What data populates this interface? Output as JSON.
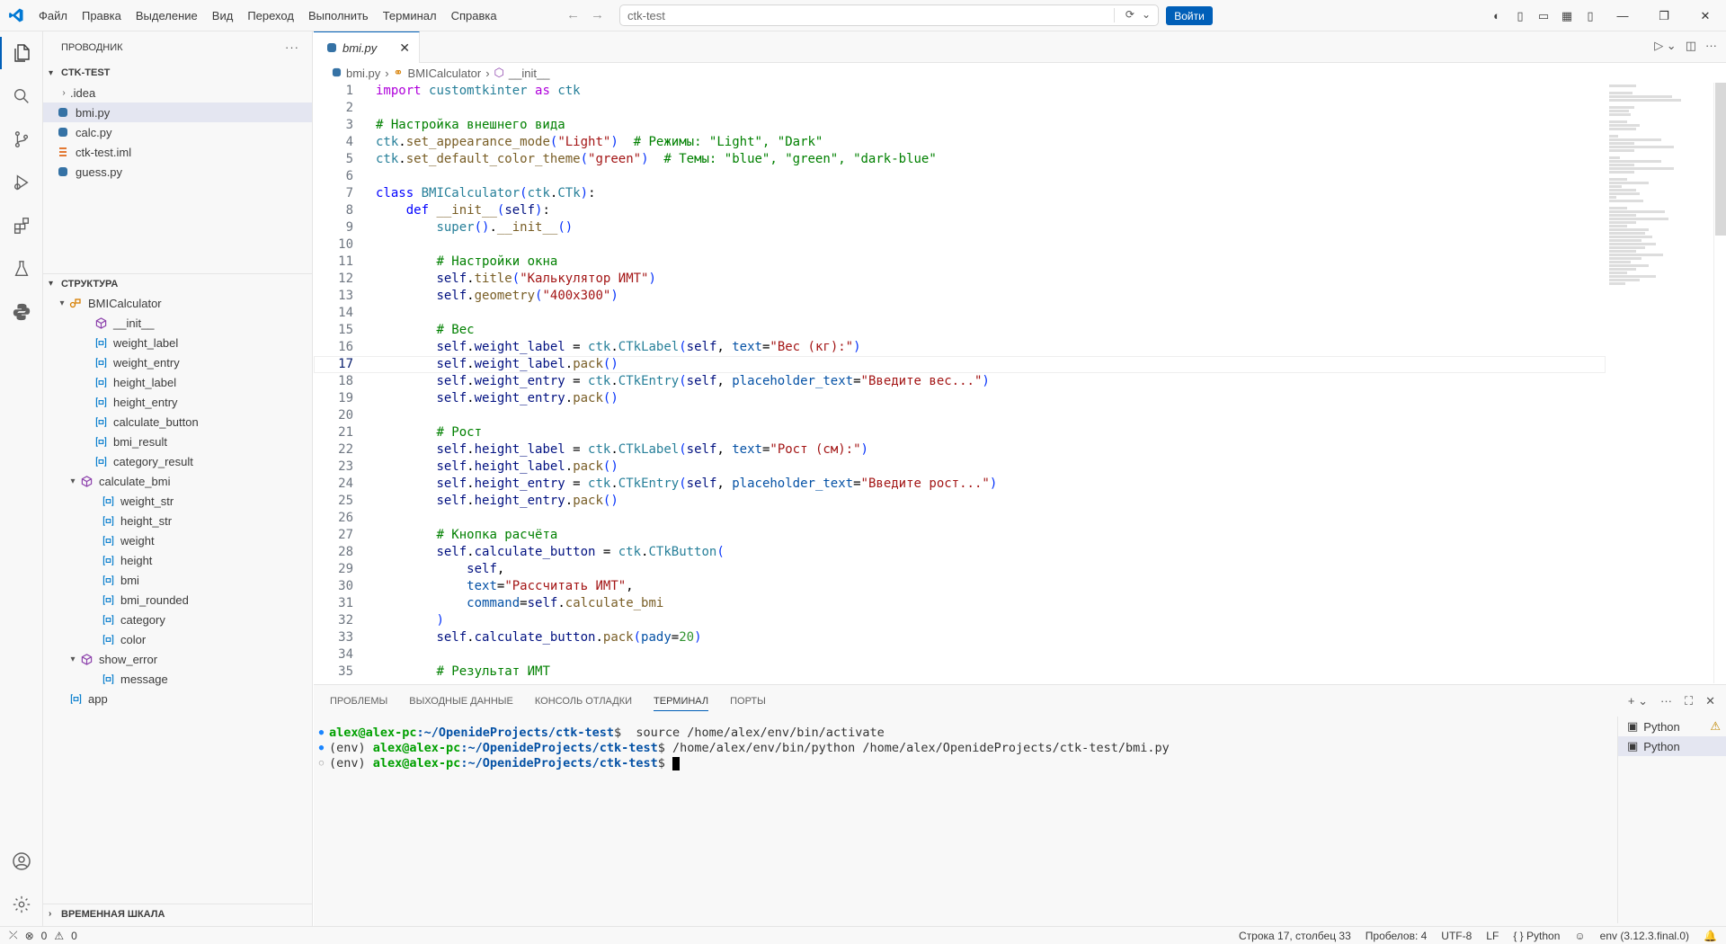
{
  "menu": [
    "Файл",
    "Правка",
    "Выделение",
    "Вид",
    "Переход",
    "Выполнить",
    "Терминал",
    "Справка"
  ],
  "command_center": "ctk-test",
  "signin_label": "Войти",
  "explorer": {
    "header": "ПРОВОДНИК",
    "project": "CTK-TEST",
    "files": [
      {
        "name": ".idea",
        "icon": "folder-icon"
      },
      {
        "name": "bmi.py",
        "icon": "python-file-icon"
      },
      {
        "name": "calc.py",
        "icon": "python-file-icon"
      },
      {
        "name": "ctk-test.iml",
        "icon": "xml-file-icon"
      },
      {
        "name": "guess.py",
        "icon": "python-file-icon"
      }
    ]
  },
  "outline": {
    "title": "СТРУКТУРА",
    "class_name": "BMICalculator",
    "items": [
      "__init__",
      "weight_label",
      "weight_entry",
      "height_label",
      "height_entry",
      "calculate_button",
      "bmi_result",
      "category_result",
      "calculate_bmi",
      "weight_str",
      "height_str",
      "weight",
      "height",
      "bmi",
      "bmi_rounded",
      "category",
      "color",
      "show_error",
      "message",
      "app"
    ]
  },
  "timeline_title": "ВРЕМЕННАЯ ШКАЛА",
  "editor": {
    "tab_label": "bmi.py",
    "breadcrumb": [
      "bmi.py",
      "BMICalculator",
      "__init__"
    ],
    "line_numbers": [
      "1",
      "2",
      "3",
      "4",
      "5",
      "6",
      "7",
      "8",
      "9",
      "10",
      "11",
      "12",
      "13",
      "14",
      "15",
      "16",
      "17",
      "18",
      "19",
      "20",
      "21",
      "22",
      "23",
      "24",
      "25",
      "26",
      "27",
      "28",
      "29",
      "30",
      "31",
      "32",
      "33",
      "34",
      "35"
    ],
    "current_line": 17
  },
  "panel": {
    "tabs": [
      "ПРОБЛЕМЫ",
      "ВЫХОДНЫЕ ДАННЫЕ",
      "КОНСОЛЬ ОТЛАДКИ",
      "ТЕРМИНАЛ",
      "ПОРТЫ"
    ],
    "active_tab": "ТЕРМИНАЛ",
    "terminal": {
      "user": "alex@alex-pc",
      "path": ":~/OpenideProjects/ctk-test",
      "env": "(env) ",
      "cmd1": "$  source /home/alex/env/bin/activate",
      "cmd2": "$ /home/alex/env/bin/python /home/alex/OpenideProjects/ctk-test/bmi.py",
      "prompt_end": "$ "
    },
    "terminal_list": [
      "Python",
      "Python"
    ]
  },
  "status": {
    "errors": "0",
    "warnings": "0",
    "position": "Строка 17, столбец 33",
    "spaces": "Пробелов: 4",
    "encoding": "UTF-8",
    "eol": "LF",
    "language": "Python",
    "interpreter": "env (3.12.3.final.0)"
  },
  "colors": {
    "accent": "#005fb8",
    "keyword": "#0000ff",
    "string": "#a31515",
    "comment": "#008000",
    "class": "#267f99"
  }
}
